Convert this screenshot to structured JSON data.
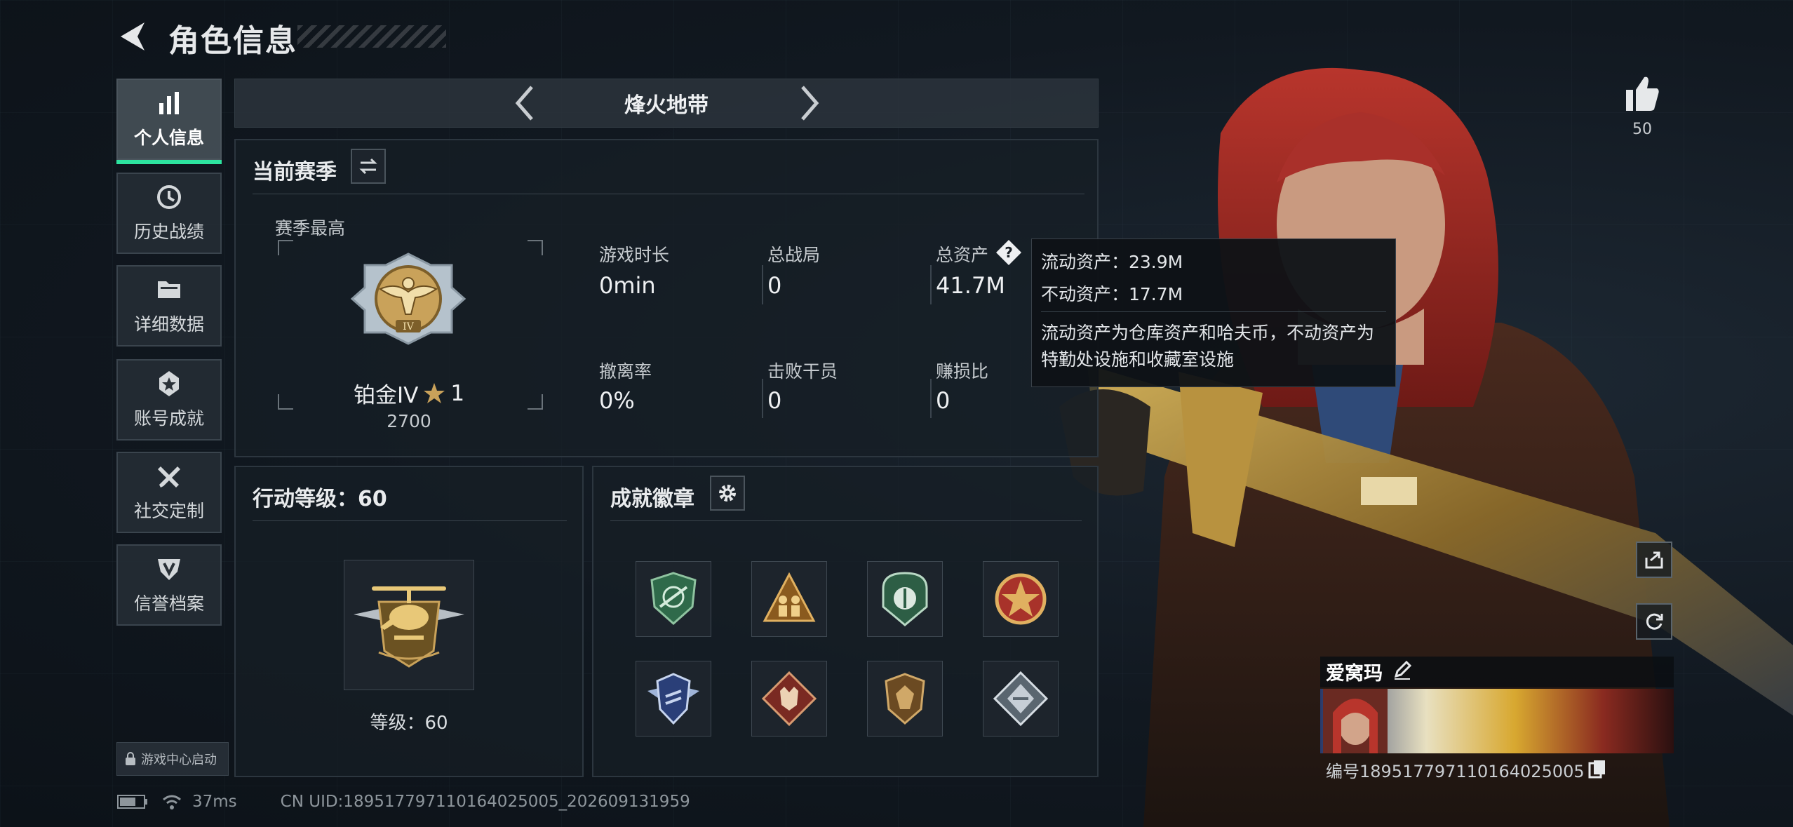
{
  "header": {
    "title": "角色信息"
  },
  "nav": {
    "items": [
      {
        "label": "个人信息",
        "icon": "bar-chart-icon"
      },
      {
        "label": "历史战绩",
        "icon": "clock-icon"
      },
      {
        "label": "详细数据",
        "icon": "folder-icon"
      },
      {
        "label": "账号成就",
        "icon": "star-badge-icon"
      },
      {
        "label": "社交定制",
        "icon": "wrench-icon"
      },
      {
        "label": "信誉档案",
        "icon": "shield-v-icon"
      }
    ],
    "launcher_label": "游戏中心启动"
  },
  "mode_switcher": {
    "title": "烽火地带"
  },
  "season": {
    "title": "当前赛季",
    "best_label": "赛季最高",
    "rank_name": "铂金IV",
    "rank_stars": "1",
    "rank_points": "2700",
    "rank_emblem_numeral": "IV",
    "stats": [
      {
        "label": "游戏时长",
        "value": "0min"
      },
      {
        "label": "总战局",
        "value": "0"
      },
      {
        "label": "总资产",
        "value": "41.7M"
      },
      {
        "label": "撤离率",
        "value": "0%"
      },
      {
        "label": "击败干员",
        "value": "0"
      },
      {
        "label": "赚损比",
        "value": "0"
      }
    ]
  },
  "action_level": {
    "title": "行动等级：60",
    "level_label": "等级：60"
  },
  "badges": {
    "title": "成就徽章",
    "items": [
      {
        "icon": "rifle-shield-badge-icon"
      },
      {
        "icon": "soldiers-triangle-badge-icon"
      },
      {
        "icon": "round-shield-badge-icon"
      },
      {
        "icon": "red-star-medal-icon"
      },
      {
        "icon": "wings-shield-badge-icon"
      },
      {
        "icon": "wolf-diamond-badge-icon"
      },
      {
        "icon": "bronze-crest-badge-icon"
      },
      {
        "icon": "steel-diamond-badge-icon"
      }
    ]
  },
  "asset_tooltip": {
    "liquid": "流动资产：23.9M",
    "fixed": "不动资产：17.7M",
    "description": "流动资产为仓库资产和哈夫币，不动资产为特勤处设施和收藏室设施"
  },
  "likes": {
    "count": "50"
  },
  "player": {
    "name": "爱窝玛",
    "uid_line": "编号1895177971101640250​05"
  },
  "status_bar": {
    "ping": "37ms",
    "cn_uid": "CN UID:1895177971101640250​05_202609131959"
  },
  "colors": {
    "accent_green": "#2de39f",
    "gold": "#c9a25a",
    "panel_bg": "#161e26"
  }
}
